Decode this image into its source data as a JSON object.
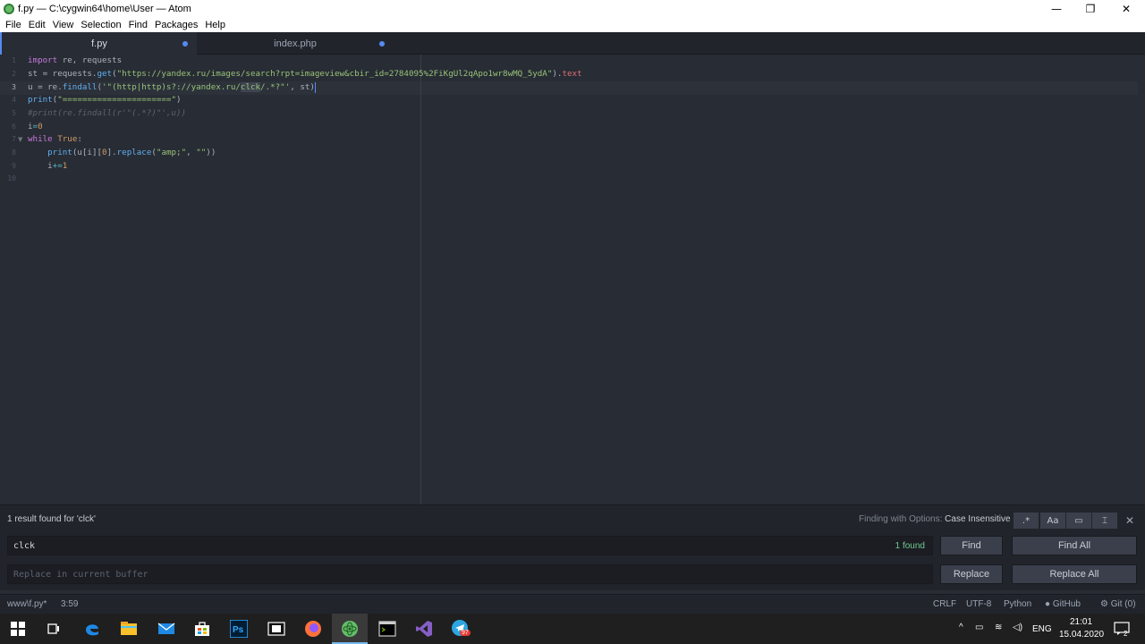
{
  "window": {
    "title": "f.py — C:\\cygwin64\\home\\User — Atom",
    "minimize": "—",
    "maximize": "❐",
    "close": "✕"
  },
  "menu": [
    "File",
    "Edit",
    "View",
    "Selection",
    "Find",
    "Packages",
    "Help"
  ],
  "tabs": [
    {
      "label": "f.py",
      "modified": true,
      "active": true
    },
    {
      "label": "index.php",
      "modified": true,
      "active": false
    }
  ],
  "editor": {
    "line_numbers": [
      "1",
      "2",
      "3",
      "4",
      "5",
      "6",
      "7",
      "8",
      "9",
      "10"
    ],
    "cursor_line": 3
  },
  "find": {
    "result_text": "1 result found for 'clck'",
    "options_label": "Finding with Options:",
    "options_value": "Case Insensitive",
    "opt_regex": ".*",
    "opt_case": "Aa",
    "opt_selection": "▭",
    "opt_word": "⌶",
    "close": "✕",
    "search_value": "clck",
    "found_count": "1 found",
    "replace_placeholder": "Replace in current buffer",
    "find_btn": "Find",
    "find_all_btn": "Find All",
    "replace_btn": "Replace",
    "replace_all_btn": "Replace All"
  },
  "status": {
    "file": "www\\f.py*",
    "position": "3:59",
    "line_ending": "CRLF",
    "encoding": "UTF-8",
    "grammar": "Python",
    "github": "GitHub",
    "git": "Git (0)"
  },
  "taskbar": {
    "language": "ENG",
    "time": "21:01",
    "date": "15.04.2020",
    "telegram_badge": "97",
    "notifications": "2"
  },
  "colors": {
    "accent": "#568af2",
    "editor_bg": "#282c34",
    "panel_bg": "#21252b"
  }
}
